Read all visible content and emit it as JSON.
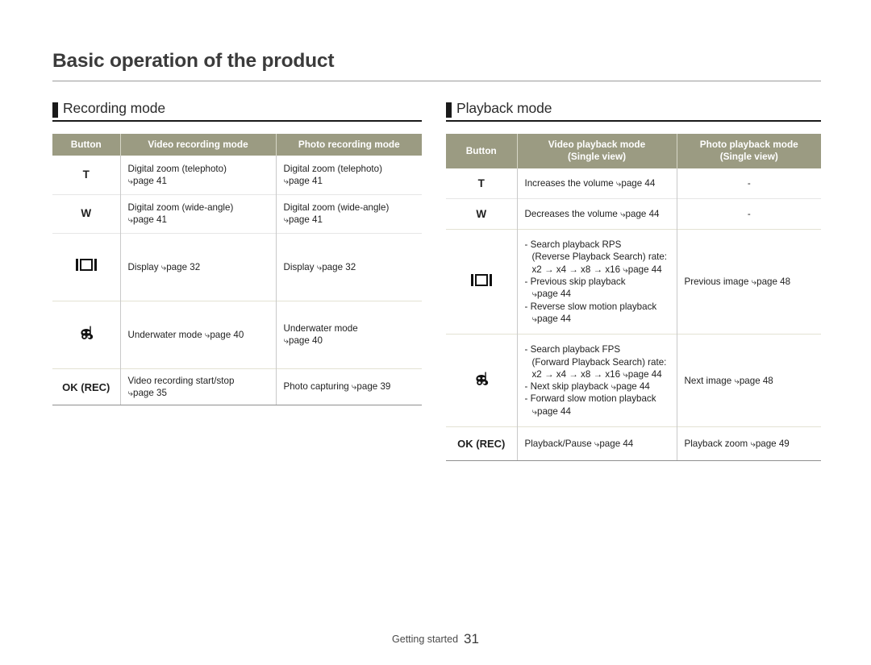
{
  "page": {
    "title": "Basic operation of the product",
    "footer_label": "Getting started",
    "page_number": "31"
  },
  "colors": {
    "table_header_bg": "#9b9b82",
    "section_marker": "#1a1a1a",
    "text": "#231f20",
    "rule": "#9a9a9a"
  },
  "icons": {
    "arrow": "⤷",
    "display": "display-icon",
    "underwater": "underwater-icon"
  },
  "sections": [
    {
      "title": "Recording mode",
      "table": {
        "columns": [
          "Button",
          "Video recording mode",
          "Photo recording mode"
        ],
        "rows": [
          {
            "button": "T",
            "button_type": "text",
            "video": [
              "Digital zoom (telephoto)",
              "⤷page 41"
            ],
            "photo": [
              "Digital zoom (telephoto)",
              "⤷page 41"
            ]
          },
          {
            "button": "W",
            "button_type": "text",
            "video": [
              "Digital zoom (wide-angle)",
              "⤷page 41"
            ],
            "photo": [
              "Digital zoom (wide-angle)",
              "⤷page 41"
            ]
          },
          {
            "button": "display-icon",
            "button_type": "icon",
            "video": [
              "Display ⤷page 32"
            ],
            "photo": [
              "Display ⤷page 32"
            ]
          },
          {
            "button": "underwater-icon",
            "button_type": "icon",
            "video": [
              "Underwater mode ⤷page 40"
            ],
            "photo": [
              "Underwater mode",
              "⤷page 40"
            ]
          },
          {
            "button": "OK (REC)",
            "button_type": "text",
            "video": [
              "Video recording start/stop",
              "⤷page 35"
            ],
            "photo": [
              "Photo capturing ⤷page 39"
            ]
          }
        ]
      }
    },
    {
      "title": "Playback mode",
      "table": {
        "columns": [
          "Button",
          "Video playback mode\n(Single view)",
          "Photo playback mode\n(Single view)"
        ],
        "column_lines": [
          [
            "Button"
          ],
          [
            "Video playback mode",
            "(Single view)"
          ],
          [
            "Photo playback mode",
            "(Single view)"
          ]
        ],
        "rows": [
          {
            "button": "T",
            "button_type": "text",
            "video": [
              "Increases the volume ⤷page 44"
            ],
            "photo": [
              "-"
            ]
          },
          {
            "button": "W",
            "button_type": "text",
            "video": [
              "Decreases the volume ⤷page 44"
            ],
            "photo": [
              "-"
            ]
          },
          {
            "button": "display-icon",
            "button_type": "icon",
            "video": [
              "- Search playback RPS",
              "(Reverse Playback Search) rate:",
              "x2 → x4 → x8 → x16 ⤷page 44",
              "- Previous skip playback",
              "⤷page 44",
              "- Reverse slow motion playback",
              "⤷page 44"
            ],
            "photo": [
              "Previous image ⤷page 48"
            ]
          },
          {
            "button": "underwater-icon",
            "button_type": "icon",
            "video": [
              "- Search playback FPS",
              "(Forward Playback Search) rate:",
              "x2 → x4 → x8 → x16 ⤷page 44",
              "- Next skip playback ⤷page 44",
              "- Forward slow motion playback",
              "⤷page 44"
            ],
            "photo": [
              "Next image ⤷page 48"
            ]
          },
          {
            "button": "OK (REC)",
            "button_type": "text",
            "video": [
              "Playback/Pause ⤷page 44"
            ],
            "photo": [
              "Playback zoom ⤷page 49"
            ]
          }
        ]
      }
    }
  ]
}
